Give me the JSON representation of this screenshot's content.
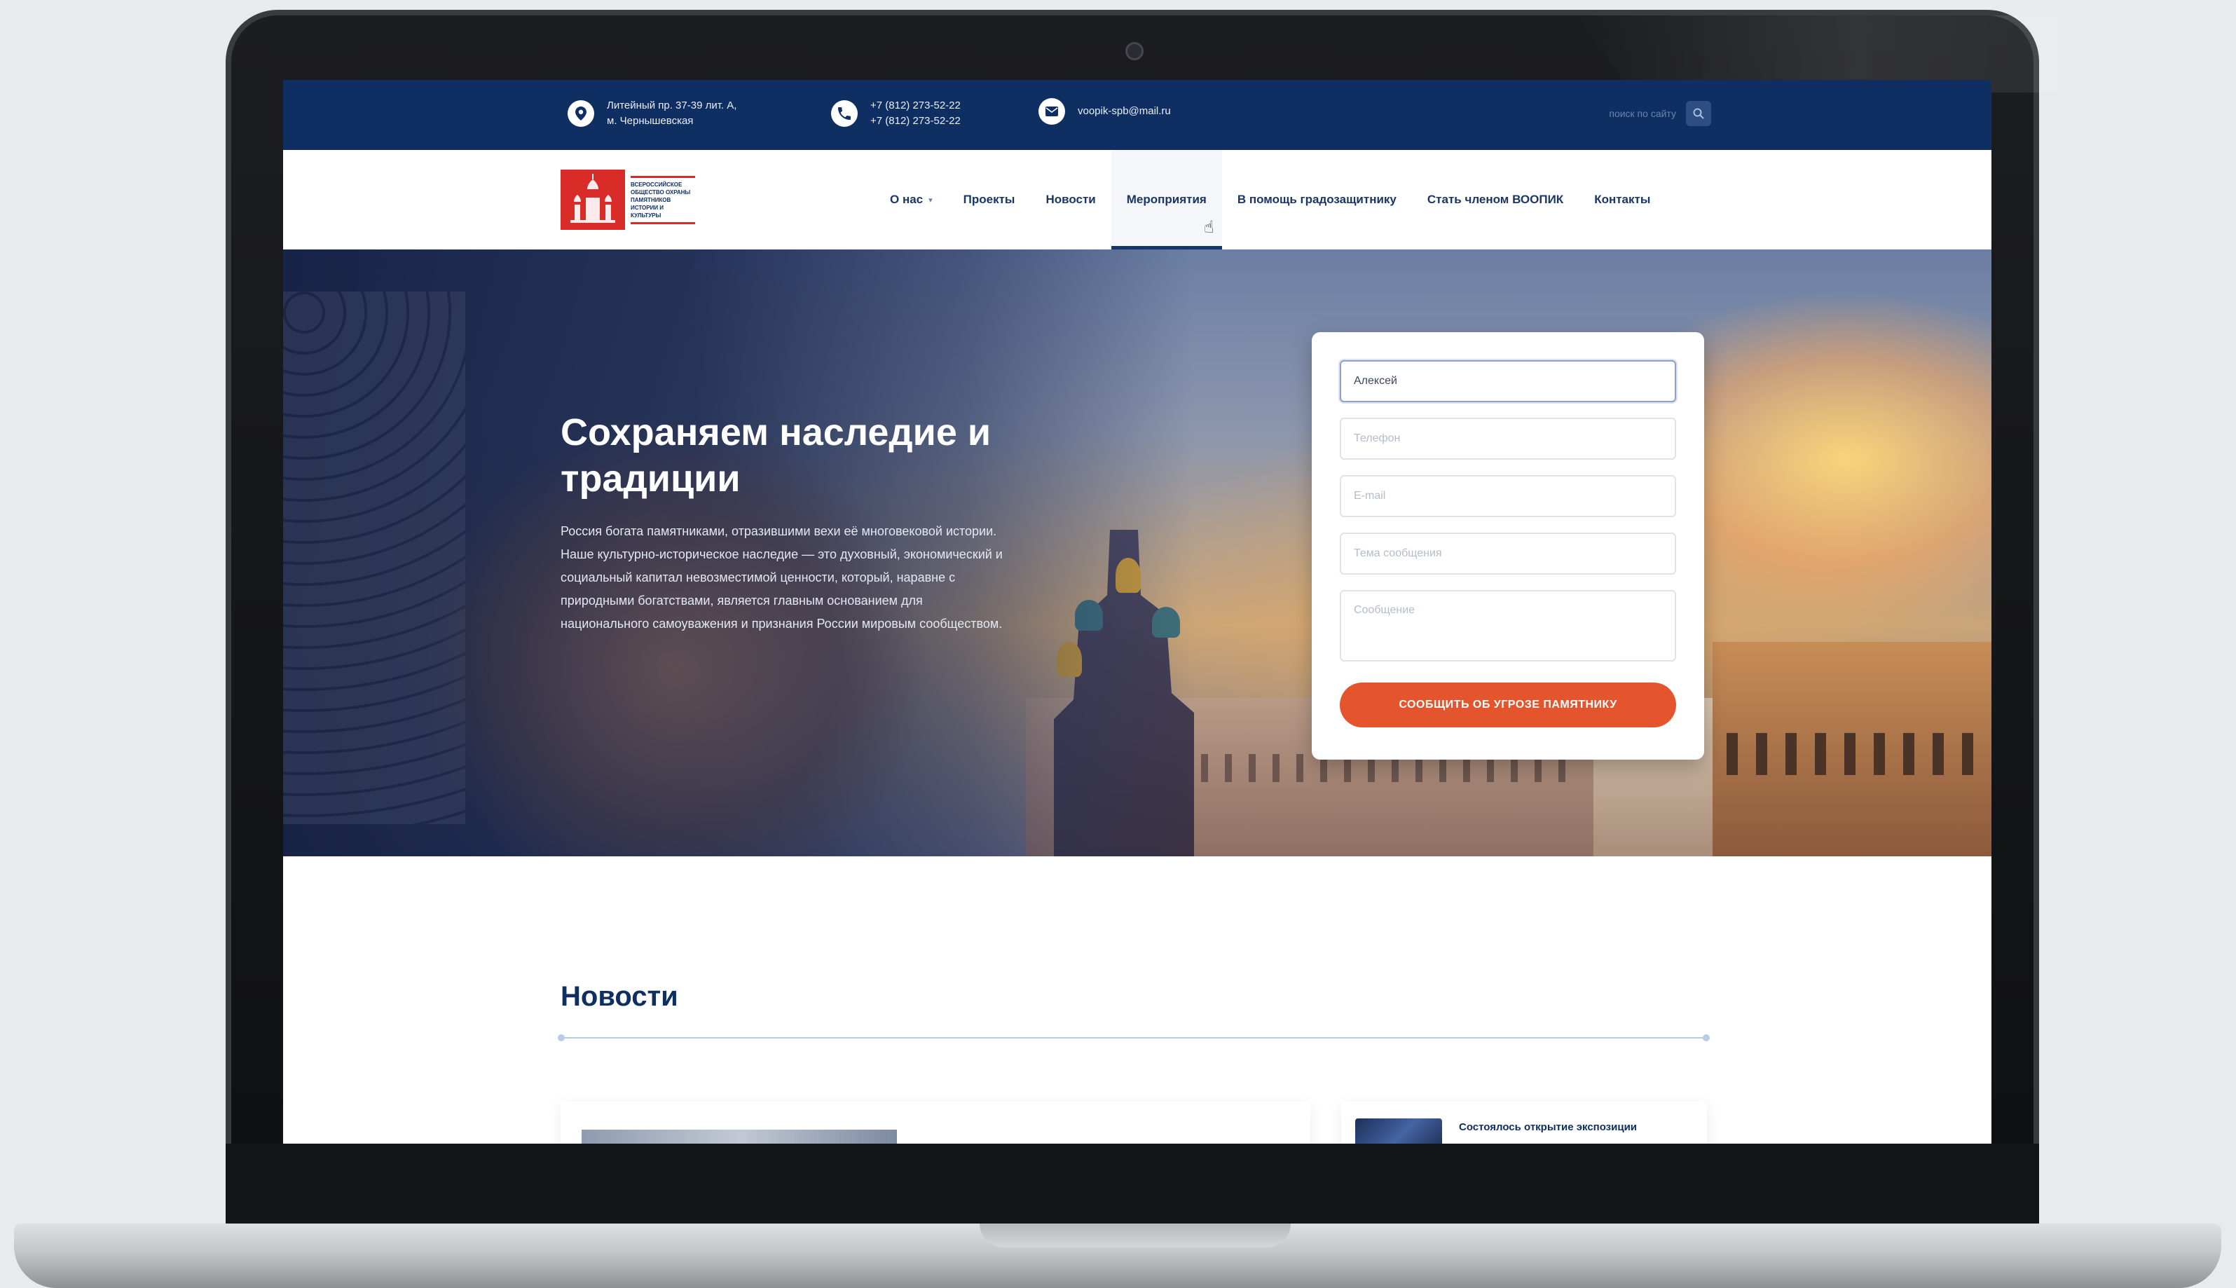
{
  "topbar": {
    "address_line1": "Литейный пр. 37-39 лит. А,",
    "address_line2": "м. Чернышевская",
    "phone1": "+7 (812) 273-52-22",
    "phone2": "+7 (812) 273-52-22",
    "email": "voopik-spb@mail.ru",
    "search_placeholder": "поиск по сайту",
    "icons": {
      "address": "map-pin-icon",
      "phone": "phone-icon",
      "email": "mail-icon",
      "search": "search-icon"
    }
  },
  "logo": {
    "text": "Всероссийское общество охраны памятников истории и культуры"
  },
  "nav": {
    "items": [
      {
        "label": "О нас",
        "has_dropdown": true
      },
      {
        "label": "Проекты"
      },
      {
        "label": "Новости"
      },
      {
        "label": "Мероприятия",
        "active": true
      },
      {
        "label": "В помощь градозащитнику"
      },
      {
        "label": "Стать членом ВООПИК"
      },
      {
        "label": "Контакты"
      }
    ]
  },
  "hero": {
    "title": "Сохраняем наследие и традиции",
    "text": "Россия богата памятниками, отразившими вехи её многовековой истории. Наше культурно-историческое наследие — это духовный, экономический и социальный капитал невозместимой ценности, который, наравне с природными богатствами, является главным основанием для национального самоуважения и признания России мировым сообществом."
  },
  "form": {
    "name_value": "Алексей",
    "phone_placeholder": "Телефон",
    "email_placeholder": "E-mail",
    "subject_placeholder": "Тема сообщения",
    "message_placeholder": "Сообщение",
    "submit_label": "СООБЩИТЬ ОБ УГРОЗЕ ПАМЯТНИКУ"
  },
  "news": {
    "title": "Новости",
    "card_small_title": "Состоялось открытие экспозиции"
  },
  "colors": {
    "brand_navy": "#0f2f63",
    "accent_orange": "#e4552e",
    "logo_red": "#d92b28"
  }
}
